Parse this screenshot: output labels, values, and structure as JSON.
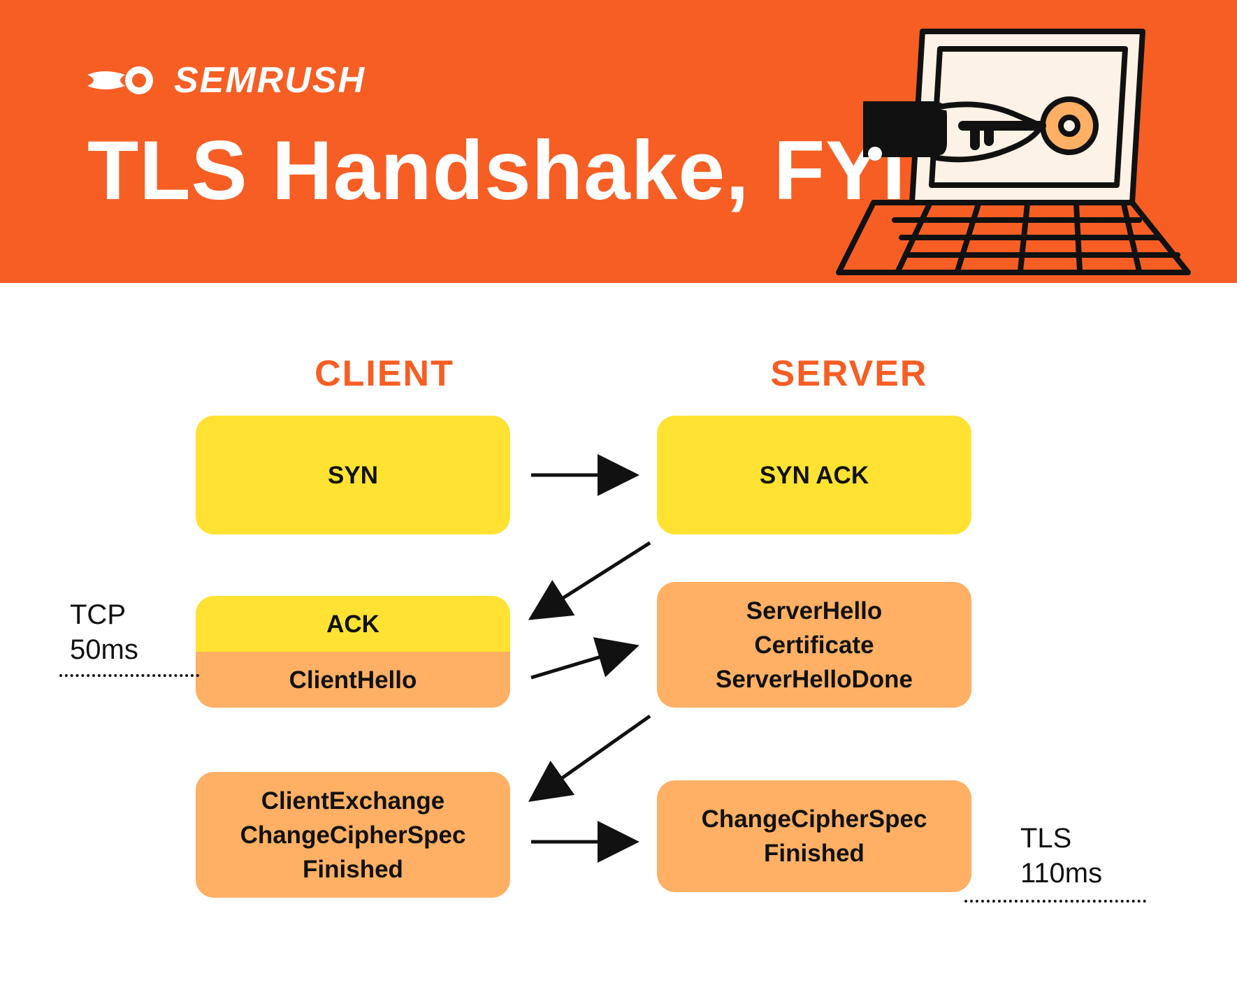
{
  "brand": "SEMRUSH",
  "title": "TLS Handshake, FYI",
  "columns": {
    "client": "CLIENT",
    "server": "SERVER"
  },
  "rows": {
    "r1": {
      "client": "SYN",
      "server": "SYN ACK"
    },
    "r2": {
      "client_top": "ACK",
      "client_bottom": "ClientHello",
      "server": "ServerHello\nCertificate\nServerHelloDone"
    },
    "r3": {
      "client": "ClientExchange\nChangeCipherSpec\nFinished",
      "server": "ChangeCipherSpec\nFinished"
    }
  },
  "annotations": {
    "tcp": {
      "label": "TCP",
      "time": "50ms"
    },
    "tls": {
      "label": "TLS",
      "time": "110ms"
    }
  }
}
